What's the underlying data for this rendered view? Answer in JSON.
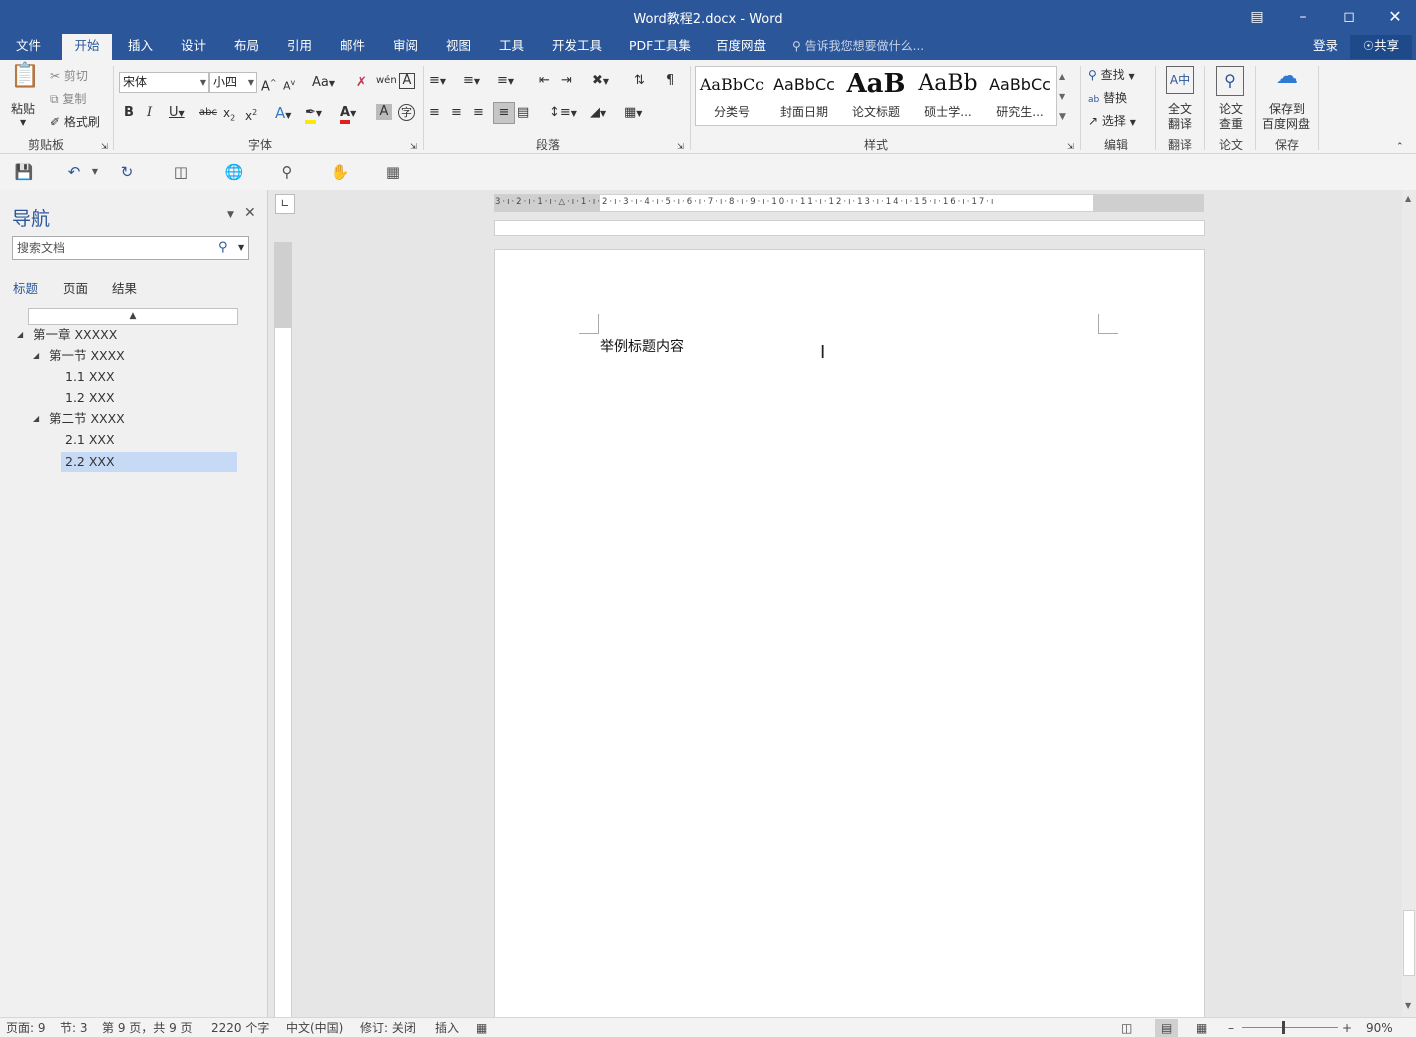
{
  "window": {
    "title": "Word教程2.docx - Word"
  },
  "tabs": [
    "文件",
    "开始",
    "插入",
    "设计",
    "布局",
    "引用",
    "邮件",
    "审阅",
    "视图",
    "工具",
    "开发工具",
    "PDF工具集",
    "百度网盘"
  ],
  "tell_me": "告诉我您想要做什么...",
  "account": {
    "login": "登录",
    "share": "共享"
  },
  "clipboard": {
    "paste": "粘贴",
    "cut": "剪切",
    "copy": "复制",
    "format_painter": "格式刷",
    "label": "剪贴板"
  },
  "font": {
    "name": "宋体",
    "size": "小四",
    "label": "字体"
  },
  "paragraph": {
    "label": "段落"
  },
  "styles": {
    "label": "样式",
    "items": [
      {
        "preview": "AaBbCc",
        "name": "分类号"
      },
      {
        "preview": "AaBbCc",
        "name": "封面日期"
      },
      {
        "preview": "AaB",
        "name": "论文标题"
      },
      {
        "preview": "AaBb",
        "name": "硕士学..."
      },
      {
        "preview": "AaBbCc",
        "name": "研究生..."
      }
    ]
  },
  "editing": {
    "find": "查找",
    "replace": "替换",
    "select": "选择",
    "label": "编辑"
  },
  "translate": {
    "btn1": "全文",
    "btn2": "翻译",
    "label": "翻译"
  },
  "paper": {
    "btn1": "论文",
    "btn2": "查重",
    "label": "论文"
  },
  "save_group": {
    "btn1": "保存到",
    "btn2": "百度网盘",
    "label": "保存"
  },
  "nav": {
    "title": "导航",
    "search_placeholder": "搜索文档",
    "tabs": [
      "标题",
      "页面",
      "结果"
    ],
    "tree": [
      "第一章 XXXXX",
      "第一节 XXXX",
      "1.1 XXX",
      "1.2 XXX",
      "第二节 XXXX",
      "2.1 XXX",
      "2.2 XXX"
    ]
  },
  "document": {
    "text": "举例标题内容"
  },
  "status": {
    "page": "页面: 9",
    "section": "节: 3",
    "pages": "第 9 页，共 9 页",
    "words": "2220 个字",
    "lang": "中文(中国)",
    "track": "修订: 关闭",
    "mode": "插入",
    "zoom": "90%"
  },
  "colors": {
    "brand": "#2b579a",
    "highlight": "#ffe800",
    "font_color": "#e02020"
  }
}
